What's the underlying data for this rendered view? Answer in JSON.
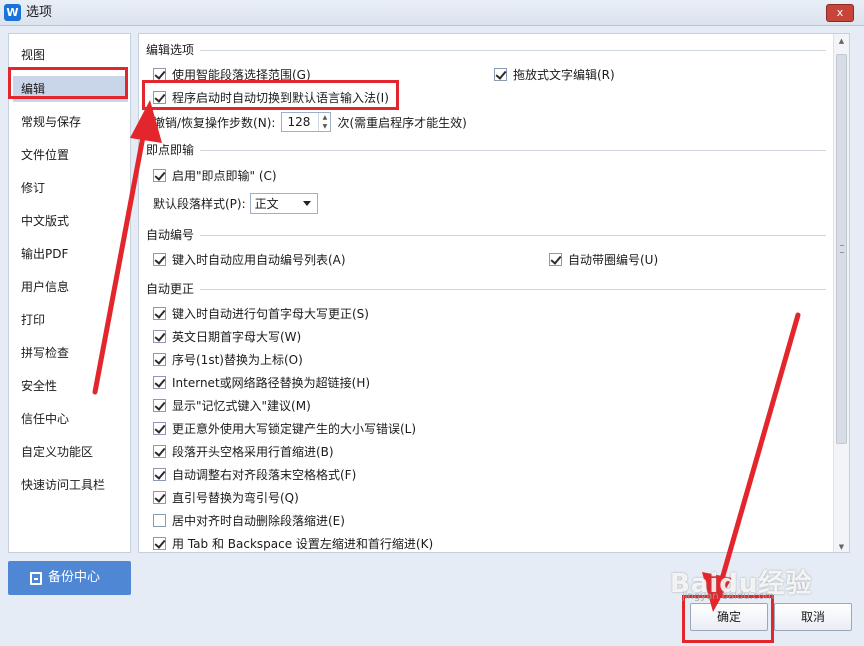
{
  "window": {
    "title": "选项",
    "app_icon": "W",
    "close": "x"
  },
  "sidebar": {
    "items": [
      {
        "label": "视图",
        "active": false
      },
      {
        "label": "编辑",
        "active": true
      },
      {
        "label": "常规与保存",
        "active": false
      },
      {
        "label": "文件位置",
        "active": false
      },
      {
        "label": "修订",
        "active": false
      },
      {
        "label": "中文版式",
        "active": false
      },
      {
        "label": "输出PDF",
        "active": false
      },
      {
        "label": "用户信息",
        "active": false
      },
      {
        "label": "打印",
        "active": false
      },
      {
        "label": "拼写检查",
        "active": false
      },
      {
        "label": "安全性",
        "active": false
      },
      {
        "label": "信任中心",
        "active": false
      },
      {
        "label": "自定义功能区",
        "active": false
      },
      {
        "label": "快速访问工具栏",
        "active": false
      }
    ],
    "backup_label": "备份中心"
  },
  "sections": {
    "edit": {
      "title": "编辑选项",
      "smart_select": "使用智能段落选择范围(G)",
      "drag_edit": "拖放式文字编辑(R)",
      "auto_ime": "程序启动时自动切换到默认语言输入法(I)",
      "undo_label": "撤销/恢复操作步数(N):",
      "undo_value": "128",
      "undo_suffix": "次(需重启程序才能生效)"
    },
    "click_type": {
      "title": "即点即输",
      "enable": "启用\"即点即输\" (C)",
      "default_style_label": "默认段落样式(P):",
      "default_style_value": "正文"
    },
    "auto_number": {
      "title": "自动编号",
      "auto_list": "键入时自动应用自动编号列表(A)",
      "auto_circle": "自动带圈编号(U)"
    },
    "autocorrect": {
      "title": "自动更正",
      "items": [
        {
          "label": "键入时自动进行句首字母大写更正(S)",
          "checked": true
        },
        {
          "label": "英文日期首字母大写(W)",
          "checked": true
        },
        {
          "label": "序号(1st)替换为上标(O)",
          "checked": true
        },
        {
          "label": "Internet或网络路径替换为超链接(H)",
          "checked": true
        },
        {
          "label": "显示\"记忆式键入\"建议(M)",
          "checked": true
        },
        {
          "label": "更正意外使用大写锁定键产生的大小写错误(L)",
          "checked": true
        },
        {
          "label": "段落开头空格采用行首缩进(B)",
          "checked": true
        },
        {
          "label": "自动调整右对齐段落末空格格式(F)",
          "checked": true
        },
        {
          "label": "直引号替换为弯引号(Q)",
          "checked": true
        },
        {
          "label": "居中对齐时自动删除段落缩进(E)",
          "checked": false
        },
        {
          "label": "用 Tab 和 Backspace 设置左缩进和首行缩进(K)",
          "checked": true
        }
      ]
    }
  },
  "buttons": {
    "ok": "确定",
    "cancel": "取消"
  },
  "watermark": {
    "text": "Baidu经验",
    "sub": "jingyan.baidu.com"
  },
  "colors": {
    "accent": "#4f87d4",
    "annotation": "#e3262b",
    "selected": "#c9d5e8"
  }
}
